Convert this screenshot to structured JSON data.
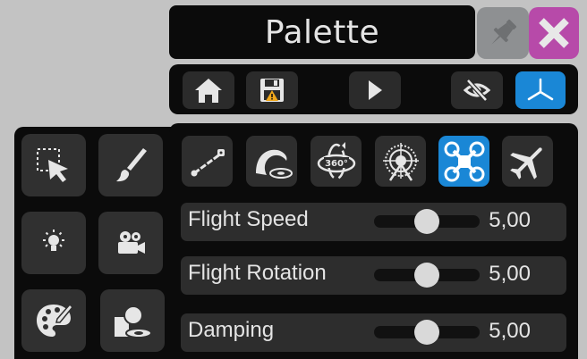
{
  "window": {
    "title": "Palette"
  },
  "colors": {
    "accent": "#1a87d6",
    "close": "#b74aa9",
    "pin": "#8e9092",
    "panel": "#0b0b0b",
    "button": "#2e2e2e",
    "text": "#e4e4e4"
  },
  "title_bar": {
    "pin_icon": "pin-icon",
    "close_icon": "close-icon"
  },
  "toolbar": {
    "items": [
      {
        "icon": "home-icon"
      },
      {
        "icon": "save-warning-icon"
      },
      {
        "icon": "play-icon"
      },
      {
        "icon": "eye-off-icon"
      },
      {
        "icon": "axis-icon",
        "active": true
      }
    ]
  },
  "tools": [
    {
      "icon": "selection-cursor-icon"
    },
    {
      "icon": "brush-icon"
    },
    {
      "icon": "light-icon"
    },
    {
      "icon": "camera-icon"
    },
    {
      "icon": "palette-icon"
    },
    {
      "icon": "environment-icon"
    }
  ],
  "modes": [
    {
      "icon": "pole-camera-icon"
    },
    {
      "icon": "orbit-icon"
    },
    {
      "icon": "360-icon",
      "label": "360°"
    },
    {
      "icon": "target-icon"
    },
    {
      "icon": "drone-icon",
      "active": true
    },
    {
      "icon": "airplane-icon"
    }
  ],
  "sliders": [
    {
      "label": "Flight Speed",
      "value": "5,00",
      "fraction": 0.5
    },
    {
      "label": "Flight Rotation",
      "value": "5,00",
      "fraction": 0.5
    },
    {
      "label": "Damping",
      "value": "5,00",
      "fraction": 0.5
    }
  ]
}
